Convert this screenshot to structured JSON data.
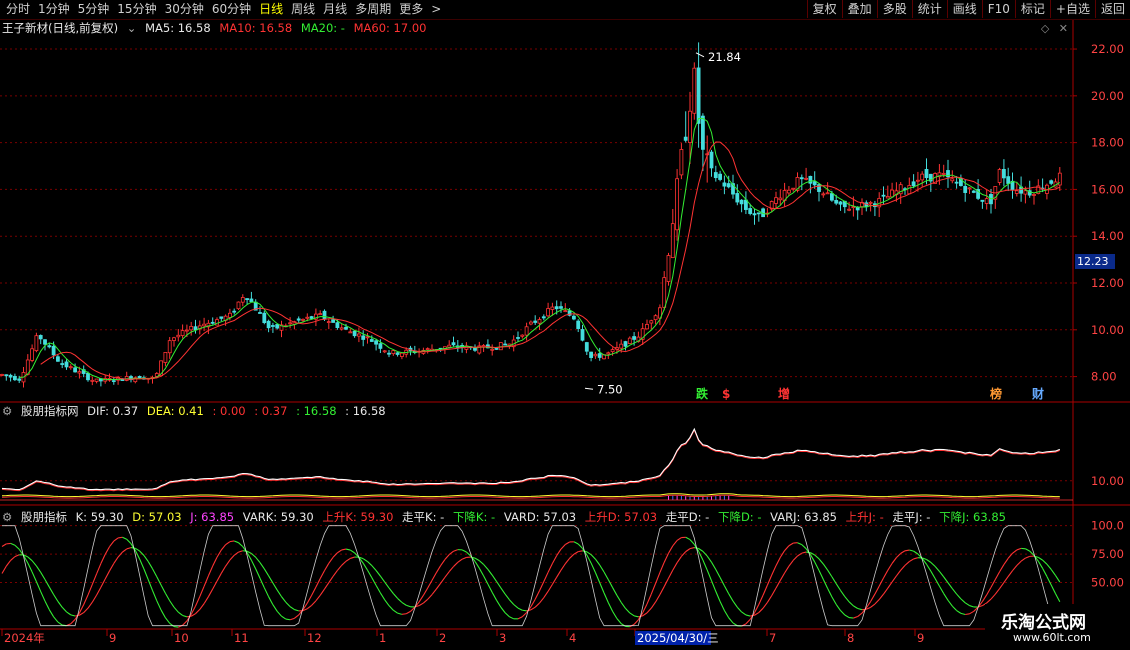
{
  "toolbar": {
    "periods": [
      "分时",
      "1分钟",
      "5分钟",
      "15分钟",
      "30分钟",
      "60分钟",
      "日线",
      "周线",
      "月线",
      "多周期",
      "更多"
    ],
    "active_period": "日线",
    "more_arrow": ">",
    "right_buttons": [
      "复权",
      "叠加",
      "多股",
      "统计",
      "画线",
      "F10",
      "+自选",
      "返回"
    ],
    "right_icon": "标记"
  },
  "main": {
    "stock_title": "王子新材(日线,前复权)",
    "dropdown_icon": "chevron-down-icon",
    "ma5": "MA5: 16.58",
    "ma10": "MA10: 16.58",
    "ma20": "MA20: -",
    "ma60": "MA60: 17.00",
    "current_price_tag": "12.23",
    "high_label": "21.84",
    "low_label": "7.50",
    "event_tags": [
      {
        "text": "跌",
        "color": "#33ee33"
      },
      {
        "text": "$",
        "color": "#ff3333"
      },
      {
        "text": "增",
        "color": "#ff3333"
      },
      {
        "text": "榜",
        "color": "#ff9933"
      },
      {
        "text": "财",
        "color": "#66aaff"
      }
    ]
  },
  "macd": {
    "title": "股朋指标网",
    "dif": "DIF: 0.37",
    "dea": "DEA: 0.41",
    "v1": ": 0.00",
    "v2": ": 0.37",
    "v3": ": 16.58",
    "v4": ": 16.58",
    "axis_label": "10.00"
  },
  "kdj": {
    "title": "股朋指标",
    "k": "K: 59.30",
    "d": "D: 57.03",
    "j": "J: 63.85",
    "vark": "VARK: 59.30",
    "up_k": "上升K: 59.30",
    "flat_k": "走平K: -",
    "down_k": "下降K: -",
    "vard": "VARD: 57.03",
    "up_d": "上升D: 57.03",
    "flat_d": "走平D: -",
    "down_d": "下降D: -",
    "varj": "VARJ: 63.85",
    "up_j": "上升J: -",
    "flat_j": "走平J: -",
    "down_j": "下降J: 63.85",
    "axis_labels": [
      "100.0",
      "75.00",
      "50.00"
    ]
  },
  "x_axis": {
    "labels": [
      "2024年",
      "9",
      "10",
      "11",
      "12",
      "1",
      "2",
      "3",
      "4",
      "2025/04/30/三",
      "7",
      "8",
      "9"
    ]
  },
  "watermark": {
    "name": "乐淘公式网",
    "url": "www.60lt.com"
  },
  "chart_data": {
    "type": "candlestick",
    "title": "王子新材(日线,前复权)",
    "y_axis_ticks": [
      8.0,
      10.0,
      12.0,
      14.0,
      16.0,
      18.0,
      20.0,
      22.0
    ],
    "ylim": [
      7.0,
      22.6
    ],
    "annotations": {
      "high": 21.84,
      "low": 7.5,
      "last_marker": 12.23
    },
    "x_period_labels": [
      "2024年",
      "9",
      "10",
      "11",
      "12",
      "1",
      "2",
      "3",
      "4",
      "2025/04/30/三",
      "7",
      "8",
      "9"
    ],
    "close_path_approx": [
      {
        "x": "2024年",
        "y": 8.0
      },
      {
        "x": "9",
        "y": 7.8
      },
      {
        "x": "10",
        "y": 9.8
      },
      {
        "x": "11",
        "y": 11.0
      },
      {
        "x": "12",
        "y": 10.2
      },
      {
        "x": "1",
        "y": 9.0
      },
      {
        "x": "2",
        "y": 9.2
      },
      {
        "x": "3",
        "y": 9.5
      },
      {
        "x": "4",
        "y": 10.8
      },
      {
        "x": "2025/04/30/三",
        "y": 10.5
      },
      {
        "x": "peak",
        "y": 21.0
      },
      {
        "x": "7",
        "y": 15.5
      },
      {
        "x": "8",
        "y": 15.5
      },
      {
        "x": "9",
        "y": 16.3
      }
    ],
    "ma_values": {
      "MA5": 16.58,
      "MA10": 16.58,
      "MA60": 17.0
    },
    "sub_panels": [
      {
        "name": "股朋指标网",
        "type": "line",
        "series": [
          {
            "name": "DIF",
            "value": 0.37
          },
          {
            "name": "DEA",
            "value": 0.41
          }
        ],
        "y_tick": 10.0
      },
      {
        "name": "股朋指标",
        "type": "line",
        "series": [
          {
            "name": "K",
            "value": 59.3
          },
          {
            "name": "D",
            "value": 57.03
          },
          {
            "name": "J",
            "value": 63.85
          }
        ],
        "y_ticks": [
          100.0,
          75.0,
          50.0
        ]
      }
    ]
  },
  "colors": {
    "up": "#ff3333",
    "down": "#44dddd",
    "grid": "#7a0000",
    "axis": "#aa0000",
    "ma5": "#ffffff",
    "ma10": "#ff3333",
    "ma20": "#33ee33",
    "ma60": "#ff3333"
  }
}
